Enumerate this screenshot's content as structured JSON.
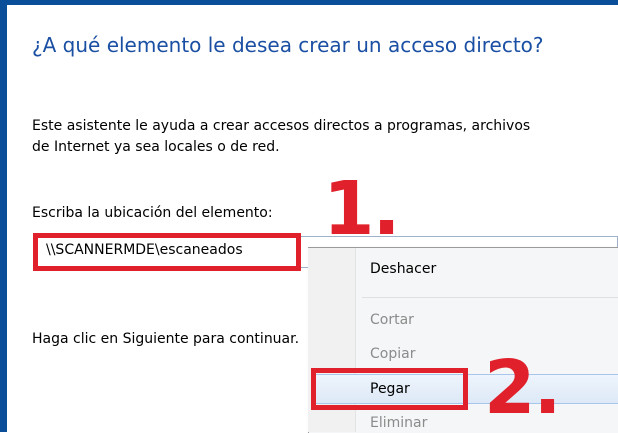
{
  "dialog": {
    "heading": "¿A qué elemento le desea crear un acceso directo?",
    "description_lines": [
      "Este asistente le ayuda a crear accesos directos a programas, archivos",
      "de Internet ya sea locales o de red."
    ],
    "location_label": "Escriba la ubicación del elemento:",
    "location_value": "\\\\SCANNERMDE\\escaneados",
    "next_hint": "Haga clic en Siguiente para continuar."
  },
  "context_menu": {
    "items": [
      {
        "label": "Deshacer",
        "enabled": true
      },
      {
        "label": "Cortar",
        "enabled": false
      },
      {
        "label": "Copiar",
        "enabled": false
      },
      {
        "label": "Pegar",
        "enabled": true,
        "hovered": true
      },
      {
        "label": "Eliminar",
        "enabled": false
      }
    ]
  },
  "annotations": {
    "step1": "1.",
    "step2": "2."
  },
  "colors": {
    "accent": "#1a4fa3",
    "frame": "#0a4e9a",
    "annotation_red": "#e0202a"
  }
}
